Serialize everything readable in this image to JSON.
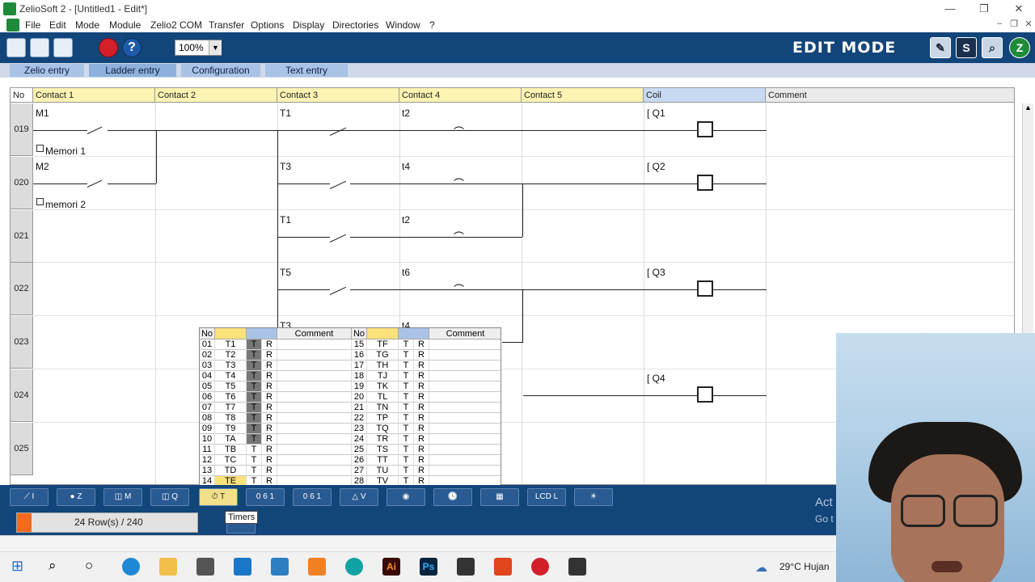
{
  "window": {
    "title": "ZelioSoft 2 - [Untitled1 - Edit*]",
    "controls": [
      "—",
      "❐",
      "✕"
    ]
  },
  "menu": [
    "File",
    "Edit",
    "Mode",
    "Module",
    "Zelio2 COM",
    "Transfer",
    "Options",
    "Display",
    "Directories",
    "Window",
    "?"
  ],
  "toolbar": {
    "zoom": "100%",
    "mode_label": "EDIT MODE",
    "right_buttons": [
      "S"
    ]
  },
  "tabs": [
    "Zelio entry",
    "Ladder entry",
    "Configuration",
    "Text entry"
  ],
  "grid": {
    "headers": [
      "No",
      "Contact 1",
      "Contact 2",
      "Contact 3",
      "Contact 4",
      "Contact 5",
      "Coil",
      "Comment"
    ],
    "rows": [
      {
        "no": "019",
        "c1": "M1",
        "c1_comment": "Memori 1",
        "c3": "T1",
        "c4": "t2",
        "coil": "Q1"
      },
      {
        "no": "020",
        "c1": "M2",
        "c1_comment": "memori 2",
        "c3": "T3",
        "c4": "t4",
        "coil": "Q2"
      },
      {
        "no": "021",
        "c1": "",
        "c1_comment": "",
        "c3": "T1",
        "c4": "t2",
        "coil": ""
      },
      {
        "no": "022",
        "c1": "",
        "c1_comment": "",
        "c3": "T5",
        "c4": "t6",
        "coil": "Q3"
      },
      {
        "no": "023",
        "c1": "",
        "c1_comment": "",
        "c3": "T3",
        "c4": "t4",
        "coil": ""
      },
      {
        "no": "024",
        "c1": "",
        "c1_comment": "",
        "c3": "",
        "c4": "",
        "coil": "Q4"
      },
      {
        "no": "025",
        "c1": "",
        "c1_comment": "",
        "c3": "",
        "c4": "",
        "coil": ""
      }
    ]
  },
  "timer_popup": {
    "headers": [
      "No",
      "",
      "",
      "Comment",
      "No",
      "",
      "",
      "Comment"
    ],
    "left": [
      [
        "01",
        "T1",
        "T",
        "R"
      ],
      [
        "02",
        "T2",
        "T",
        "R"
      ],
      [
        "03",
        "T3",
        "T",
        "R"
      ],
      [
        "04",
        "T4",
        "T",
        "R"
      ],
      [
        "05",
        "T5",
        "T",
        "R"
      ],
      [
        "06",
        "T6",
        "T",
        "R"
      ],
      [
        "07",
        "T7",
        "T",
        "R"
      ],
      [
        "08",
        "T8",
        "T",
        "R"
      ],
      [
        "09",
        "T9",
        "T",
        "R"
      ],
      [
        "10",
        "TA",
        "T",
        "R"
      ],
      [
        "11",
        "TB",
        "T",
        "R"
      ],
      [
        "12",
        "TC",
        "T",
        "R"
      ],
      [
        "13",
        "TD",
        "T",
        "R"
      ],
      [
        "14",
        "TE",
        "T",
        "R"
      ]
    ],
    "right": [
      [
        "15",
        "TF",
        "T",
        "R"
      ],
      [
        "16",
        "TG",
        "T",
        "R"
      ],
      [
        "17",
        "TH",
        "T",
        "R"
      ],
      [
        "18",
        "TJ",
        "T",
        "R"
      ],
      [
        "19",
        "TK",
        "T",
        "R"
      ],
      [
        "20",
        "TL",
        "T",
        "R"
      ],
      [
        "21",
        "TN",
        "T",
        "R"
      ],
      [
        "22",
        "TP",
        "T",
        "R"
      ],
      [
        "23",
        "TQ",
        "T",
        "R"
      ],
      [
        "24",
        "TR",
        "T",
        "R"
      ],
      [
        "25",
        "TS",
        "T",
        "R"
      ],
      [
        "26",
        "TT",
        "T",
        "R"
      ],
      [
        "27",
        "TU",
        "T",
        "R"
      ],
      [
        "28",
        "TV",
        "T",
        "R"
      ]
    ]
  },
  "bottom": {
    "palette_letters": [
      "I",
      "Z",
      "M",
      "Q",
      "T",
      "",
      "",
      "V",
      "",
      "",
      "",
      "L",
      ""
    ],
    "rows_status": "24 Row(s) / 240",
    "tooltip": "Timers",
    "activate": "Act",
    "goto": "Go t"
  },
  "taskbar": {
    "weather": "29°C  Hujan"
  }
}
